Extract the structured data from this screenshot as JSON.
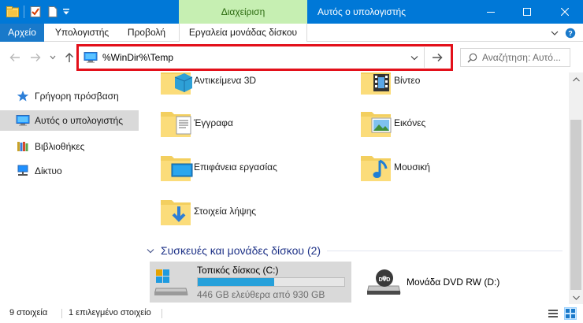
{
  "window": {
    "title": "Αυτός ο υπολογιστής",
    "context_tab": "Διαχείριση",
    "accent": "#0078d7",
    "context_color": "#c6efb2"
  },
  "quick_access": [
    "properties-icon",
    "new-folder-icon",
    "customize-dropdown-icon"
  ],
  "ribbon": {
    "file": "Αρχείο",
    "tabs": [
      "Υπολογιστής",
      "Προβολή",
      "Εργαλεία μονάδας δίσκου"
    ]
  },
  "address_bar": {
    "path": "%WinDir%\\Temp",
    "highlight_color": "#e3101a"
  },
  "search": {
    "placeholder": "Αναζήτηση: Αυτό..."
  },
  "nav_pane": {
    "items": [
      {
        "label": "Γρήγορη πρόσβαση",
        "icon": "star-icon"
      },
      {
        "label": "Αυτός ο υπολογιστής",
        "icon": "computer-icon",
        "selected": true
      },
      {
        "label": "Βιβλιοθήκες",
        "icon": "library-icon"
      },
      {
        "label": "Δίκτυο",
        "icon": "network-icon"
      }
    ]
  },
  "folders": [
    {
      "label": "Αντικείμενα 3D",
      "icon": "3d-objects-icon"
    },
    {
      "label": "Βίντεο",
      "icon": "videos-icon"
    },
    {
      "label": "Έγγραφα",
      "icon": "documents-icon"
    },
    {
      "label": "Εικόνες",
      "icon": "pictures-icon"
    },
    {
      "label": "Επιφάνεια εργασίας",
      "icon": "desktop-icon"
    },
    {
      "label": "Μουσική",
      "icon": "music-icon"
    },
    {
      "label": "Στοιχεία λήψης",
      "icon": "downloads-icon"
    }
  ],
  "devices": {
    "header": "Συσκευές και μονάδες δίσκου (2)",
    "drive_c": {
      "name": "Τοπικός δίσκος (C:)",
      "free_text": "446 GB ελεύθερα από 930 GB",
      "used_fraction": 0.52
    },
    "dvd": {
      "name": "Μονάδα DVD RW (D:)"
    }
  },
  "status": {
    "items": "9 στοιχεία",
    "selected": "1 επιλεγμένο στοιχείο"
  }
}
